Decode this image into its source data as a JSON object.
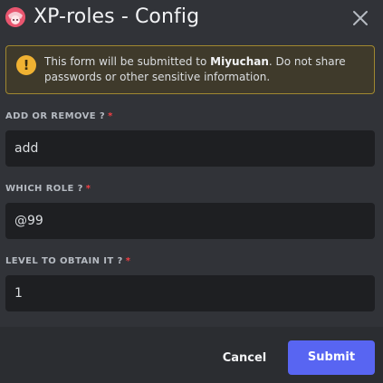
{
  "header": {
    "title": "XP-roles - Config",
    "app_icon": "anime-avatar-icon",
    "close_icon": "close-icon"
  },
  "warning": {
    "icon": "exclamation-icon",
    "text_prefix": "This form will be submitted to ",
    "app_name": "Miyuchan",
    "text_suffix": ". Do not share",
    "text_line2": "passwords or other sensitive information."
  },
  "fields": [
    {
      "label": "ADD OR REMOVE ?",
      "required_mark": "*",
      "value": "add"
    },
    {
      "label": "WHICH ROLE ?",
      "required_mark": "*",
      "value": "@99"
    },
    {
      "label": "LEVEL TO OBTAIN IT ?",
      "required_mark": "*",
      "value": "1"
    }
  ],
  "footer": {
    "cancel_label": "Cancel",
    "submit_label": "Submit"
  },
  "colors": {
    "background": "#313338",
    "footer": "#2b2d31",
    "input": "#1e1f22",
    "accent": "#5865f2",
    "warning_border": "#a08830",
    "warning_icon": "#f0b232",
    "required": "#f23f43"
  }
}
